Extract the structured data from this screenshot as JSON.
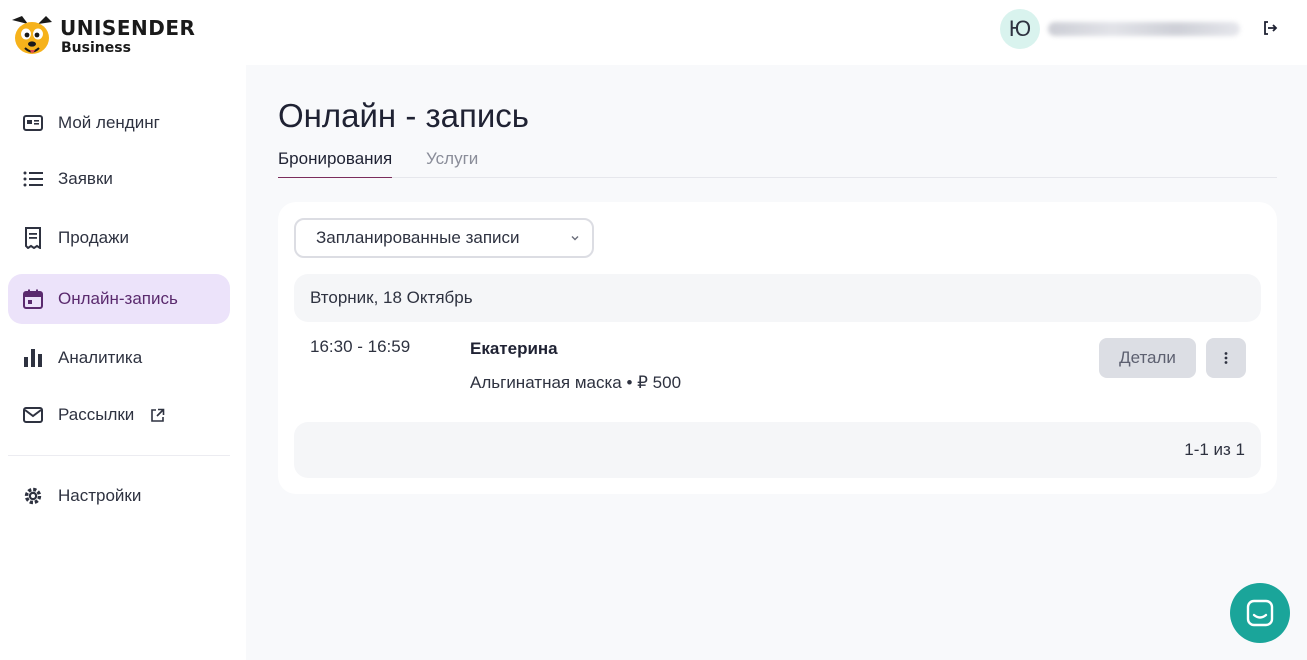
{
  "header": {
    "brand": "UNISENDER",
    "brand_sub": "Business",
    "avatar_letter": "Ю",
    "logout_icon": "logout-icon"
  },
  "sidebar": {
    "items": [
      {
        "label": "Мой лендинг",
        "icon": "landing-icon",
        "active": false
      },
      {
        "label": "Заявки",
        "icon": "list-icon",
        "active": false
      },
      {
        "label": "Продажи",
        "icon": "receipt-icon",
        "active": false
      },
      {
        "label": "Онлайн-запись",
        "icon": "calendar-icon",
        "active": true
      },
      {
        "label": "Аналитика",
        "icon": "bar-chart-icon",
        "active": false
      },
      {
        "label": "Рассылки",
        "icon": "mail-icon",
        "active": false,
        "external": true
      },
      {
        "label": "Настройки",
        "icon": "gear-icon",
        "active": false
      }
    ]
  },
  "main": {
    "title": "Онлайн - запись",
    "tabs": [
      {
        "label": "Бронирования",
        "active": true
      },
      {
        "label": "Услуги",
        "active": false
      }
    ],
    "filter": {
      "selected": "Запланированные записи"
    },
    "day_label": "Вторник, 18 Октябрь",
    "bookings": [
      {
        "time": "16:30 - 16:59",
        "client": "Екатерина",
        "service": "Альгинатная маска • ₽ 500",
        "details_label": "Детали"
      }
    ],
    "pagination": "1-1 из 1"
  },
  "colors": {
    "accent": "#5a2a6e",
    "active_bg": "#ece3fa",
    "chat": "#1aa59a",
    "tab_underline": "#7b2d5c"
  }
}
